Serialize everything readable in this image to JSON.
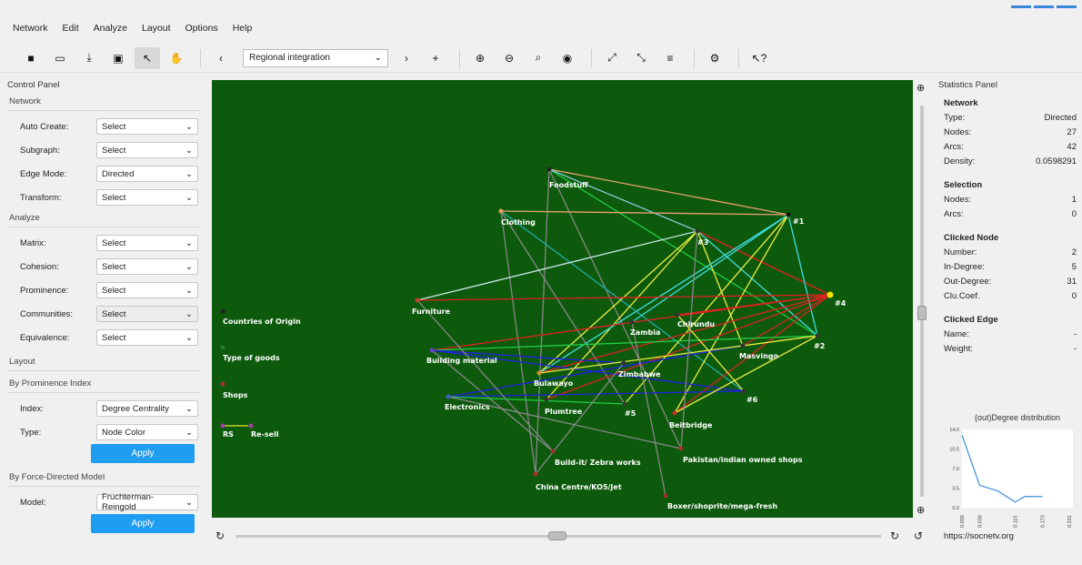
{
  "menu": [
    "Network",
    "Edit",
    "Analyze",
    "Layout",
    "Options",
    "Help"
  ],
  "toolbar": {
    "relation": "Regional integration"
  },
  "control_panel": {
    "title": "Control Panel",
    "network_header": "Network",
    "network_rows": [
      {
        "label": "Auto Create:",
        "value": "Select"
      },
      {
        "label": "Subgraph:",
        "value": "Select"
      },
      {
        "label": "Edge Mode:",
        "value": "Directed"
      },
      {
        "label": "Transform:",
        "value": "Select"
      }
    ],
    "analyze_header": "Analyze",
    "analyze_rows": [
      {
        "label": "Matrix:",
        "value": "Select"
      },
      {
        "label": "Cohesion:",
        "value": "Select"
      },
      {
        "label": "Prominence:",
        "value": "Select"
      },
      {
        "label": "Communities:",
        "value": "Select"
      },
      {
        "label": "Equivalence:",
        "value": "Select"
      }
    ],
    "layout_header": "Layout",
    "prominence_header": "By Prominence Index",
    "index_label": "Index:",
    "index_value": "Degree Centrality",
    "type_label": "Type:",
    "type_value": "Node Color",
    "apply1": "Apply",
    "force_header": "By Force-Directed Model",
    "model_label": "Model:",
    "model_value": "Fruchterman-Reingold",
    "apply2": "Apply"
  },
  "graph": {
    "bg": "#0d5a0d",
    "nodes": [
      {
        "id": "foodstuff",
        "label": "Foodstuff",
        "c": "#222"
      },
      {
        "id": "clothing",
        "label": "Clothing",
        "c": "#e0a060"
      },
      {
        "id": "n3",
        "label": "#3",
        "c": "#333"
      },
      {
        "id": "n1",
        "label": "#1",
        "c": "#111"
      },
      {
        "id": "n4",
        "label": "#4",
        "c": "#f2e200"
      },
      {
        "id": "n2",
        "label": "#2",
        "c": "#333"
      },
      {
        "id": "furniture",
        "label": "Furniture",
        "c": "#c04030"
      },
      {
        "id": "zambia",
        "label": "Zambia",
        "c": "#333"
      },
      {
        "id": "chirundu",
        "label": "Chirundu",
        "c": "#333"
      },
      {
        "id": "masvingo",
        "label": "Masvingo",
        "c": "#333"
      },
      {
        "id": "building",
        "label": "Building material",
        "c": "#7040c0"
      },
      {
        "id": "zimbabwe",
        "label": "Zimbabwe",
        "c": "#333"
      },
      {
        "id": "bulawayo",
        "label": "Bulawayo",
        "c": "#d09030"
      },
      {
        "id": "n6",
        "label": "#6",
        "c": "#333"
      },
      {
        "id": "electronics",
        "label": "Electronics",
        "c": "#4060c0"
      },
      {
        "id": "plumtree",
        "label": "Plumtree",
        "c": "#333"
      },
      {
        "id": "n5",
        "label": "#5",
        "c": "#333"
      },
      {
        "id": "beitbridge",
        "label": "Beitbridge",
        "c": "#c03030"
      },
      {
        "id": "buildit",
        "label": "Build-it/ Zebra works",
        "c": "#a03030"
      },
      {
        "id": "pakistan",
        "label": "Pakistan/indian owned shops",
        "c": "#a03030"
      },
      {
        "id": "china",
        "label": "China Centre/KO5/Jet",
        "c": "#a03030"
      },
      {
        "id": "boxer",
        "label": "Boxer/shoprite/mega-fresh",
        "c": "#a03030"
      },
      {
        "id": "legend_origin",
        "label": "Countries of Origin",
        "c": "#222"
      },
      {
        "id": "legend_goods",
        "label": "Type of goods",
        "c": "#2a7a2a"
      },
      {
        "id": "legend_shops",
        "label": "Shops",
        "c": "#a03030"
      },
      {
        "id": "legend_rs",
        "label": "RS",
        "c": "#a040a0"
      },
      {
        "id": "legend_resell",
        "label": "Re-sell",
        "c": "#a040a0"
      }
    ],
    "edges": [
      [
        "foodstuff",
        "n1",
        "#e6a070"
      ],
      [
        "foodstuff",
        "n2",
        "#22cc44"
      ],
      [
        "foodstuff",
        "n3",
        "#88ccdd"
      ],
      [
        "foodstuff",
        "china",
        "#888"
      ],
      [
        "foodstuff",
        "pakistan",
        "#888"
      ],
      [
        "clothing",
        "n1",
        "#e6a070"
      ],
      [
        "clothing",
        "n5",
        "#888"
      ],
      [
        "clothing",
        "n6",
        "#22aaaa"
      ],
      [
        "clothing",
        "china",
        "#888"
      ],
      [
        "n3",
        "furniture",
        "#cce6e6"
      ],
      [
        "n3",
        "n4",
        "#e02020"
      ],
      [
        "n3",
        "bulawayo",
        "#eeee40"
      ],
      [
        "n3",
        "plumtree",
        "#eeee40"
      ],
      [
        "n3",
        "masvingo",
        "#eeee40"
      ],
      [
        "n3",
        "n2",
        "#40dddd"
      ],
      [
        "n1",
        "n2",
        "#40dddd"
      ],
      [
        "n1",
        "n5",
        "#eeee40"
      ],
      [
        "n1",
        "beitbridge",
        "#eeee40"
      ],
      [
        "n1",
        "zambia",
        "#40dddd"
      ],
      [
        "n1",
        "bulawayo",
        "#40dddd"
      ],
      [
        "n4",
        "furniture",
        "#e02020"
      ],
      [
        "n4",
        "building",
        "#e02020"
      ],
      [
        "n4",
        "bulawayo",
        "#e02020"
      ],
      [
        "n4",
        "plumtree",
        "#e02020"
      ],
      [
        "n4",
        "beitbridge",
        "#e02020"
      ],
      [
        "n4",
        "masvingo",
        "#e02020"
      ],
      [
        "n4",
        "chirundu",
        "#e02020"
      ],
      [
        "building",
        "n2",
        "#22cc44"
      ],
      [
        "building",
        "zimbabwe",
        "#2020e0"
      ],
      [
        "building",
        "n6",
        "#2020e0"
      ],
      [
        "building",
        "buildit",
        "#888"
      ],
      [
        "electronics",
        "masvingo",
        "#2020e0"
      ],
      [
        "electronics",
        "n6",
        "#2020e0"
      ],
      [
        "electronics",
        "n5",
        "#22cc44"
      ],
      [
        "electronics",
        "pakistan",
        "#888"
      ],
      [
        "furniture",
        "buildit",
        "#888"
      ],
      [
        "bulawayo",
        "n2",
        "#eeee40"
      ],
      [
        "chirundu",
        "n6",
        "#eeee40"
      ],
      [
        "zambia",
        "boxer",
        "#888"
      ],
      [
        "beitbridge",
        "n2",
        "#eeee40"
      ],
      [
        "zimbabwe",
        "china",
        "#888"
      ],
      [
        "n3",
        "pakistan",
        "#888"
      ]
    ]
  },
  "stats": {
    "title": "Statistics Panel",
    "network_title": "Network",
    "network": [
      {
        "k": "Type:",
        "v": "Directed"
      },
      {
        "k": "Nodes:",
        "v": "27"
      },
      {
        "k": "Arcs:",
        "v": "42"
      },
      {
        "k": "Density:",
        "v": "0.0598291"
      }
    ],
    "selection_title": "Selection",
    "selection": [
      {
        "k": "Nodes:",
        "v": "1"
      },
      {
        "k": "Arcs:",
        "v": "0"
      }
    ],
    "clicked_title": "Clicked Node",
    "clicked": [
      {
        "k": "Number:",
        "v": "2"
      },
      {
        "k": "In-Degree:",
        "v": "5"
      },
      {
        "k": "Out-Degree:",
        "v": "31"
      },
      {
        "k": "Clu.Coef.",
        "v": "0"
      }
    ],
    "edge_title": "Clicked Edge",
    "edge": [
      {
        "k": "Name:",
        "v": "-"
      },
      {
        "k": "Weight:",
        "v": "-"
      }
    ],
    "url": "https://socnetv.org"
  },
  "chart_data": {
    "type": "line",
    "title": "(out)Degree distribution",
    "x": [
      "0.000",
      "0.038",
      "0.115",
      "0.173",
      "0.231"
    ],
    "yticks": [
      "0.0",
      "3.5",
      "7.0",
      "10.5",
      "14.0"
    ],
    "ylim": [
      0,
      14
    ],
    "series": [
      {
        "values": [
          13,
          4,
          3,
          1,
          2,
          2
        ]
      }
    ],
    "x_values": [
      0,
      0.038,
      0.077,
      0.115,
      0.135,
      0.173,
      0.231
    ]
  }
}
